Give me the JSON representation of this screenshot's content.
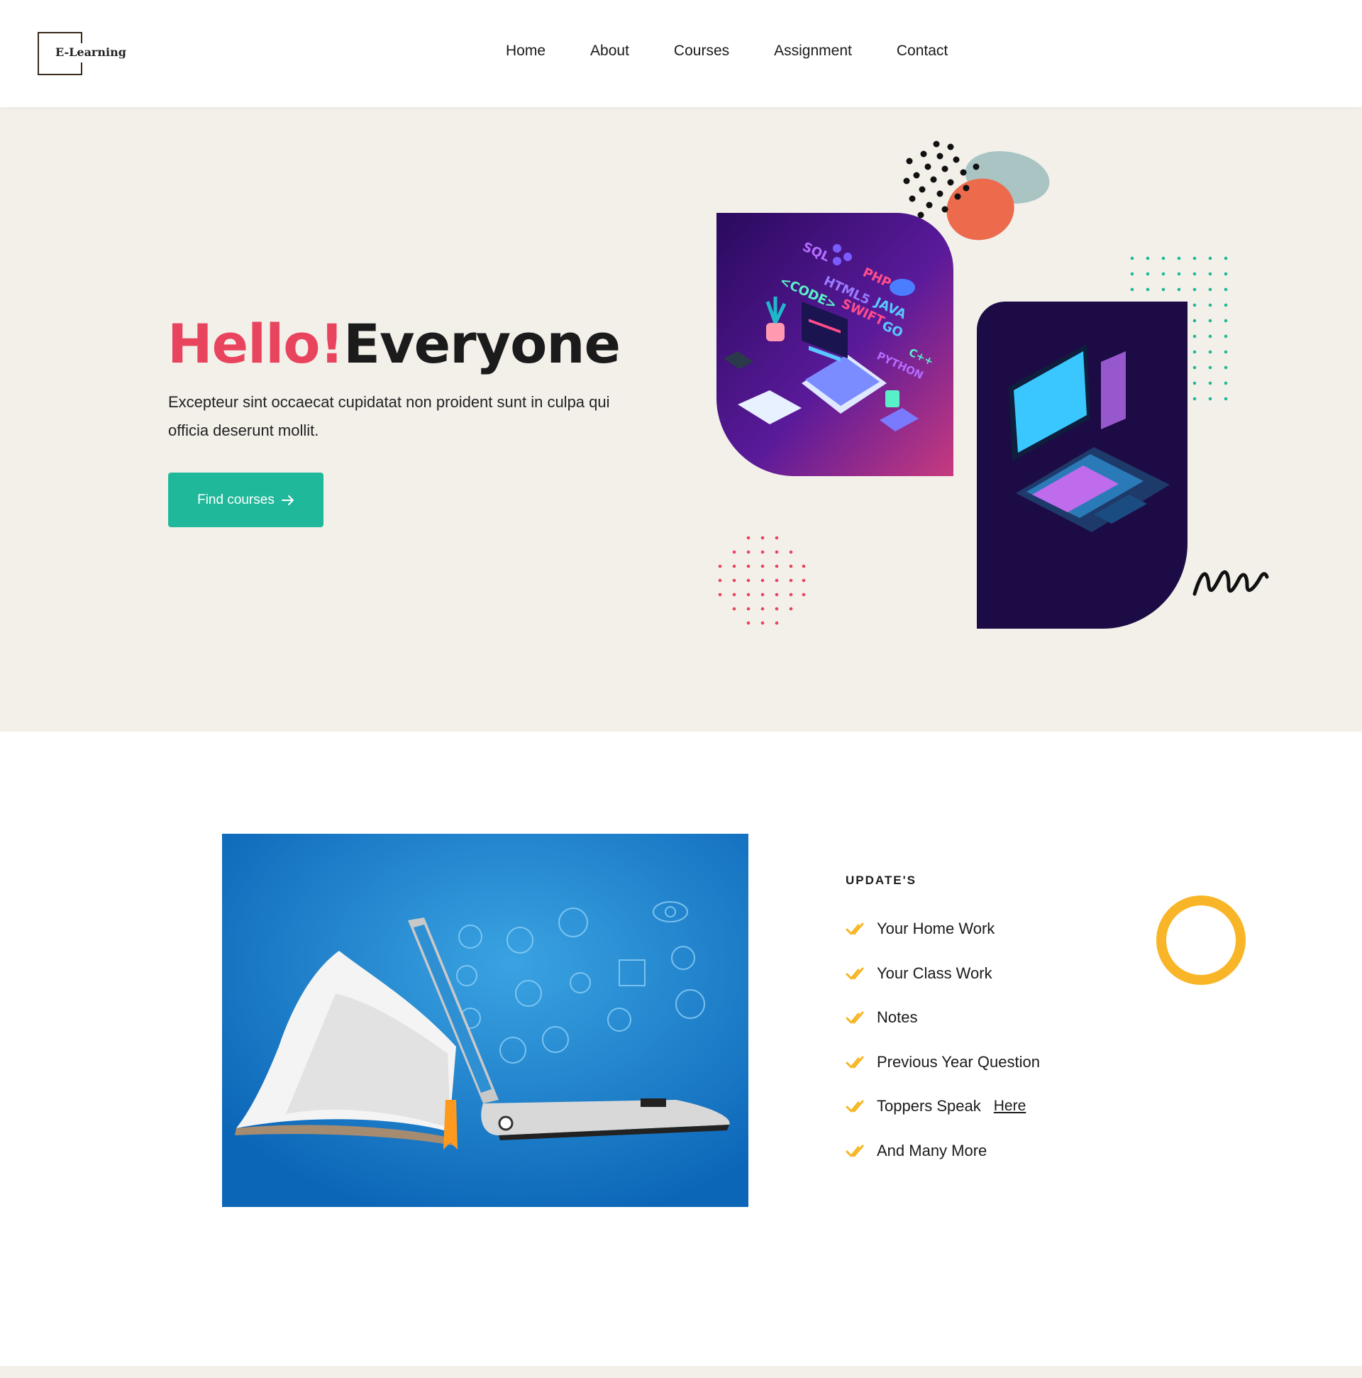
{
  "logo": {
    "text": "E-Learning"
  },
  "nav": {
    "items": [
      "Home",
      "About",
      "Courses",
      "Assignment",
      "Contact"
    ]
  },
  "hero": {
    "title_accent": "Hello!",
    "title_main": "Everyone",
    "description": "Excepteur sint occaecat cupidatat non proident sunt in culpa qui officia deserunt mollit.",
    "cta_label": "Find courses",
    "code_labels": [
      "SQL",
      "PHP",
      "HTML5",
      "<CODE>",
      "SWIFT",
      "JAVA",
      "GO",
      "PYTHON",
      "C++"
    ]
  },
  "updates": {
    "title": "UPDATE'S",
    "items": [
      {
        "label": "Your Home Work"
      },
      {
        "label": "Your Class Work"
      },
      {
        "label": "Notes"
      },
      {
        "label": "Previous Year Question"
      },
      {
        "label": "Toppers Speak",
        "link": "Here"
      },
      {
        "label": "And Many More"
      }
    ]
  },
  "colors": {
    "accent_red": "#e9445e",
    "button_teal": "#1fb89a",
    "hero_bg": "#f3f0ea",
    "ring_yellow": "#f8b527",
    "card_purple": "#1c0b45"
  }
}
